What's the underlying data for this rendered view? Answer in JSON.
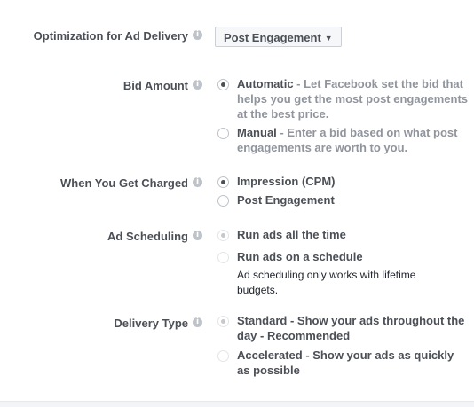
{
  "optimization": {
    "label": "Optimization for Ad Delivery",
    "info_icon": "i",
    "dropdown_value": "Post Engagement"
  },
  "bid_amount": {
    "label": "Bid Amount",
    "info_icon": "i",
    "options": [
      {
        "title": "Automatic",
        "description": " - Let Facebook set the bid that helps you get the most post engagements at the best price.",
        "checked": true
      },
      {
        "title": "Manual",
        "description": " - Enter a bid based on what post engagements are worth to you.",
        "checked": false
      }
    ]
  },
  "charged": {
    "label": "When You Get Charged",
    "info_icon": "i",
    "options": [
      {
        "title": "Impression (CPM)",
        "checked": true
      },
      {
        "title": "Post Engagement",
        "checked": false
      }
    ]
  },
  "scheduling": {
    "label": "Ad Scheduling",
    "info_icon": "i",
    "options": [
      {
        "title": "Run ads all the time",
        "checked": true
      },
      {
        "title": "Run ads on a schedule",
        "checked": false
      }
    ],
    "note": "Ad scheduling only works with lifetime budgets."
  },
  "delivery": {
    "label": "Delivery Type",
    "info_icon": "i",
    "options": [
      {
        "title": "Standard - Show your ads throughout the day - Recommended",
        "checked": true
      },
      {
        "title": "Accelerated - Show your ads as quickly as possible",
        "checked": false
      }
    ]
  }
}
